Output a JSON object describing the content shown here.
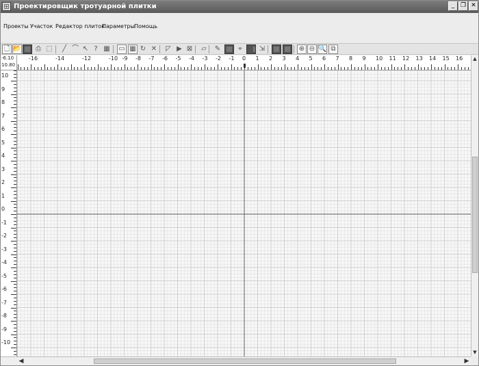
{
  "window": {
    "title": "Проектировщик тротуарной плитки",
    "minimize_glyph": "_",
    "maximize_glyph": "❐",
    "close_glyph": "✕"
  },
  "menu": {
    "items": [
      {
        "label": "Проекты"
      },
      {
        "label": "Участок"
      },
      {
        "label": "Редактор плиток"
      },
      {
        "label": "Параметры"
      },
      {
        "label": "Помощь"
      }
    ]
  },
  "toolbar": {
    "buttons": [
      {
        "icon": "new-file-icon",
        "glyph": "🗋"
      },
      {
        "icon": "open-folder-icon",
        "glyph": "📂"
      },
      {
        "icon": "save-icon",
        "glyph": ""
      },
      {
        "icon": "print-icon",
        "glyph": "⎙"
      },
      {
        "icon": "select-rect-icon",
        "glyph": "⬚"
      },
      {
        "icon": "line-icon",
        "glyph": "╱"
      },
      {
        "icon": "arc-icon",
        "glyph": "⌒"
      },
      {
        "icon": "pointer-icon",
        "glyph": "↖"
      },
      {
        "icon": "help-icon",
        "glyph": "?"
      },
      {
        "icon": "tile-icon",
        "glyph": "▦"
      },
      {
        "icon": "rectangle-icon",
        "glyph": "▭"
      },
      {
        "icon": "grid-tile-icon",
        "glyph": "▦"
      },
      {
        "icon": "rotate-icon",
        "glyph": "↻"
      },
      {
        "icon": "delete-icon",
        "glyph": "✕"
      },
      {
        "icon": "flip-icon",
        "glyph": "◸"
      },
      {
        "icon": "play-icon",
        "glyph": "▶"
      },
      {
        "icon": "cross-box-icon",
        "glyph": "⊠"
      },
      {
        "icon": "eraser-icon",
        "glyph": "▱"
      },
      {
        "icon": "pencil-icon",
        "glyph": "✎"
      },
      {
        "icon": "fill-icon",
        "glyph": ""
      },
      {
        "icon": "node-icon",
        "glyph": "⌖"
      },
      {
        "icon": "stamp-icon",
        "glyph": "◉"
      },
      {
        "icon": "arrow-tool-icon",
        "glyph": "⇲"
      },
      {
        "icon": "color-a-icon",
        "glyph": ""
      },
      {
        "icon": "color-b-icon",
        "glyph": ""
      },
      {
        "icon": "zoom-in-icon",
        "glyph": "⊕"
      },
      {
        "icon": "zoom-out-icon",
        "glyph": "⊖"
      },
      {
        "icon": "zoom-icon",
        "glyph": "🔍"
      },
      {
        "icon": "zoom-fit-icon",
        "glyph": "⧉"
      }
    ]
  },
  "coords": {
    "x": "-6.10",
    "y": "10.80"
  },
  "ruler": {
    "x_labels": [
      "-16",
      "-14",
      "-12",
      "-10",
      "-9",
      "-8",
      "-7",
      "-6",
      "-5",
      "-4",
      "-3",
      "-2",
      "-1",
      "0",
      "1",
      "2",
      "3",
      "4",
      "5",
      "6",
      "7",
      "8",
      "9",
      "10",
      "11",
      "12",
      "13",
      "14",
      "15",
      "16"
    ],
    "y_labels": [
      "10",
      "9",
      "8",
      "7",
      "6",
      "5",
      "4",
      "3",
      "2",
      "1",
      "0",
      "-1",
      "-2",
      "-3",
      "-4",
      "-5",
      "-6",
      "-7",
      "-8",
      "-9",
      "-10"
    ]
  },
  "scroll": {
    "left": "◀",
    "right": "▶",
    "up": "▲",
    "down": "▼"
  },
  "colors": {
    "grid_minor": "#dcdcdc",
    "grid_major": "#c8c8c8",
    "axis": "#777777"
  }
}
